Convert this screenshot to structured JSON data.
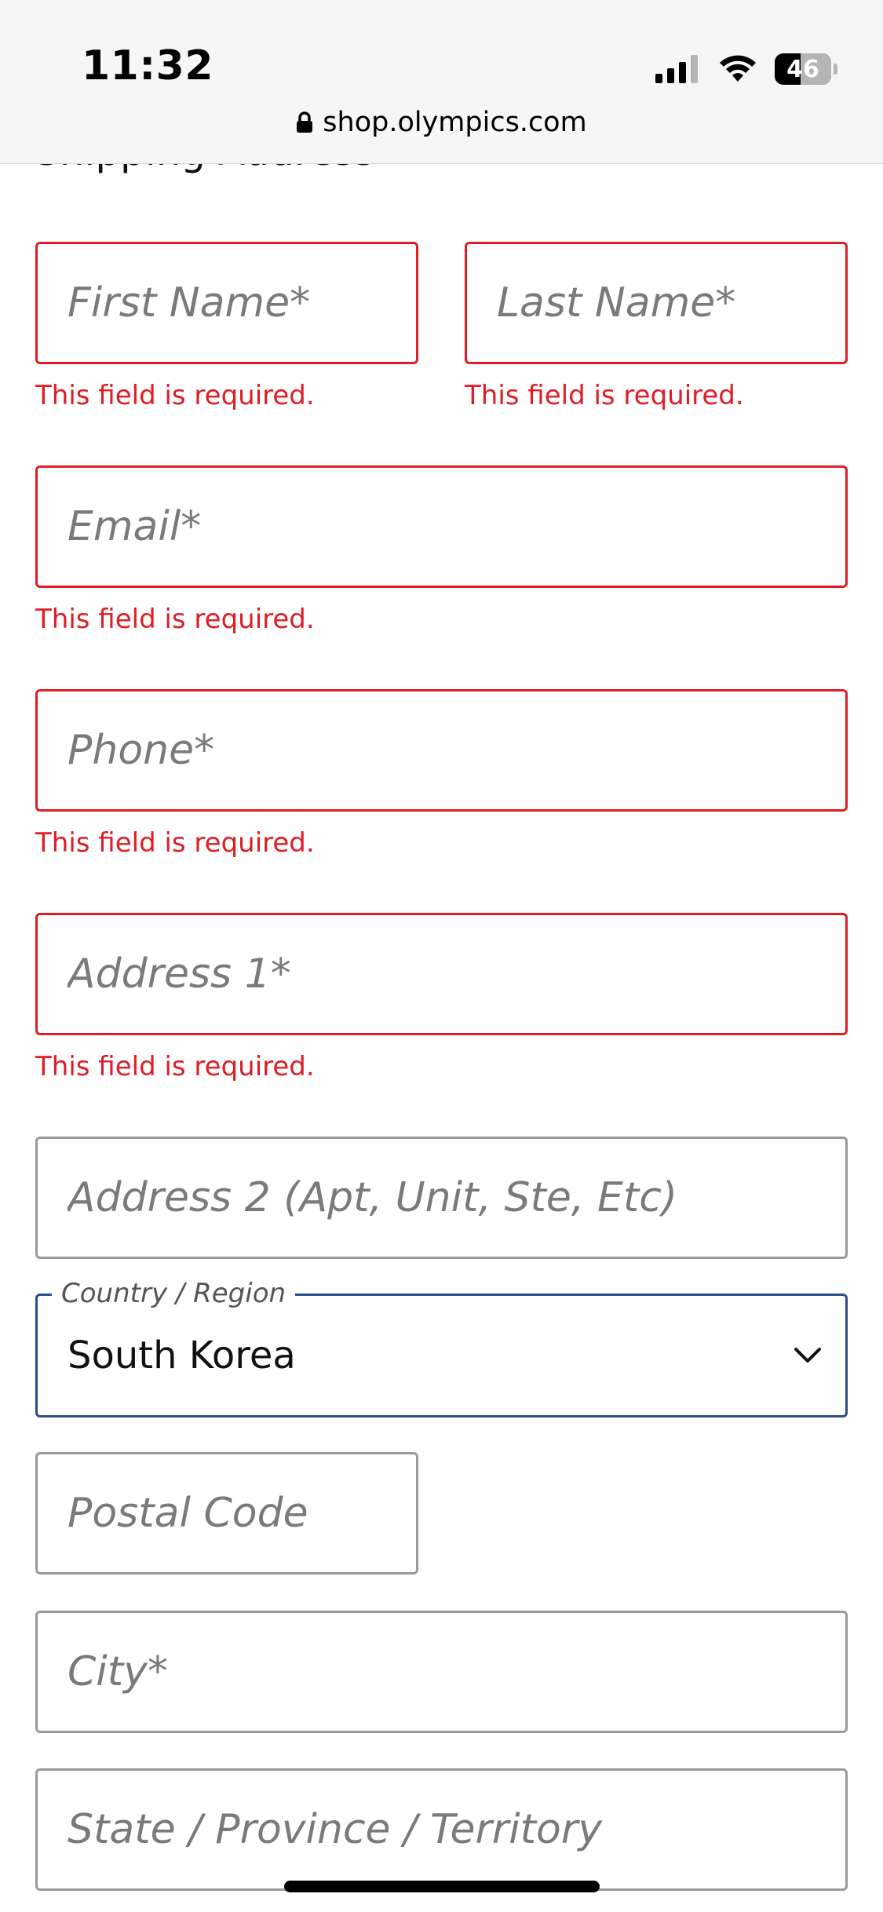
{
  "status_bar": {
    "time": "11:32",
    "battery_level": "46",
    "battery_fraction": 0.46,
    "icons": [
      "cellular-signal-icon",
      "wifi-icon",
      "battery-icon"
    ]
  },
  "browser": {
    "url": "shop.olympics.com",
    "icon": "lock-icon"
  },
  "form": {
    "section_heading": "Shipping Address",
    "first_name": {
      "placeholder": "First Name*",
      "error": "This field is required."
    },
    "last_name": {
      "placeholder": "Last Name*",
      "error": "This field is required."
    },
    "email": {
      "placeholder": "Email*",
      "error": "This field is required."
    },
    "phone": {
      "placeholder": "Phone*",
      "error": "This field is required."
    },
    "address1": {
      "placeholder": "Address 1*",
      "error": "This field is required."
    },
    "address2": {
      "placeholder": "Address 2 (Apt, Unit, Ste, Etc)"
    },
    "country": {
      "label": "Country / Region",
      "value": "South Korea"
    },
    "postal_code": {
      "placeholder": "Postal Code"
    },
    "city": {
      "placeholder": "City*"
    },
    "state": {
      "placeholder": "State / Province / Territory"
    }
  },
  "colors": {
    "error": "#e01c24",
    "focus_border": "#2b4b8c",
    "field_border": "#9a9a9a",
    "placeholder": "#7a7a7a"
  }
}
